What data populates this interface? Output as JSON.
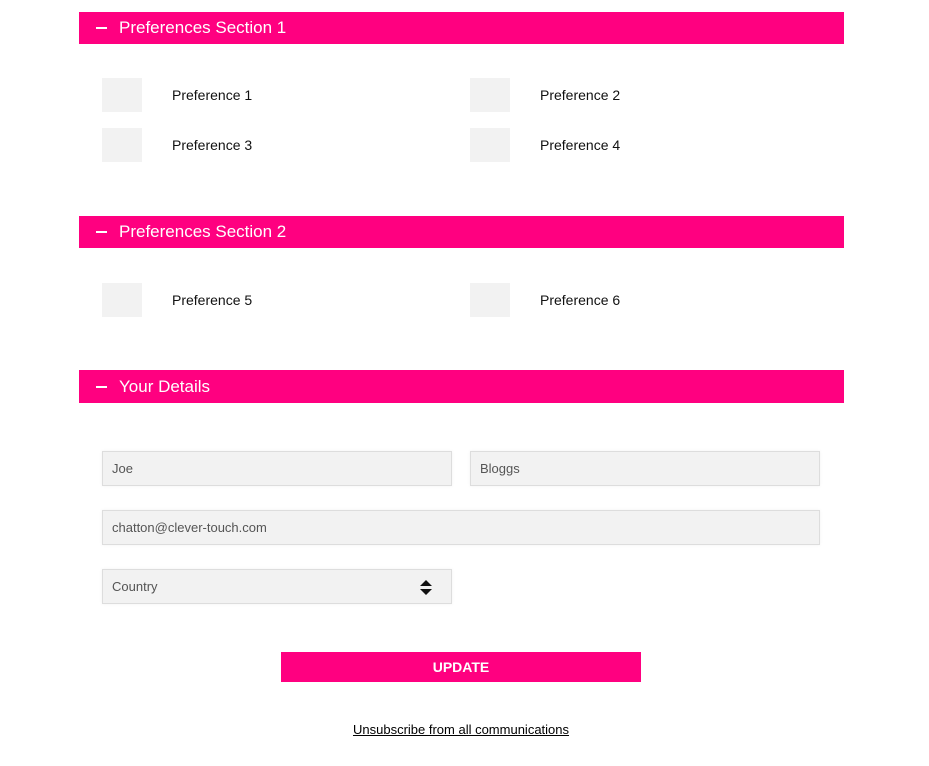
{
  "sections": [
    {
      "title": "Preferences Section 1"
    },
    {
      "title": "Preferences Section 2"
    },
    {
      "title": "Your Details"
    }
  ],
  "preferences": [
    "Preference 1",
    "Preference 2",
    "Preference 3",
    "Preference 4",
    "Preference 5",
    "Preference 6"
  ],
  "details": {
    "first_name": "Joe",
    "last_name": "Bloggs",
    "email": "chatton@clever-touch.com",
    "country_placeholder": "Country"
  },
  "update_label": "UPDATE",
  "unsubscribe_label": "Unsubscribe from all communications",
  "accent": "#ff0080"
}
